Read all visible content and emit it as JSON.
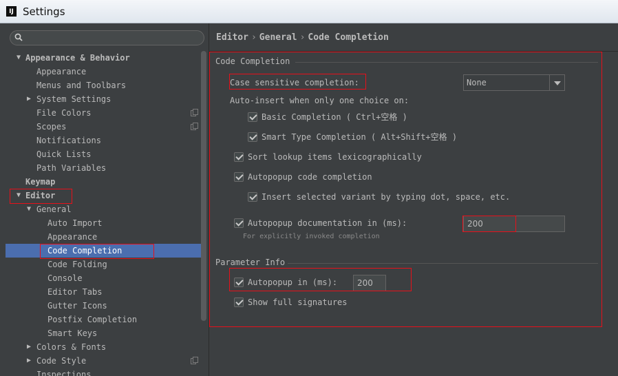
{
  "window": {
    "title": "Settings",
    "app_icon": "IJ"
  },
  "search": {
    "placeholder": ""
  },
  "tree": {
    "appearance_behavior": "Appearance & Behavior",
    "appearance": "Appearance",
    "menus_toolbars": "Menus and Toolbars",
    "system_settings": "System Settings",
    "file_colors": "File Colors",
    "scopes": "Scopes",
    "notifications": "Notifications",
    "quick_lists": "Quick Lists",
    "path_variables": "Path Variables",
    "keymap": "Keymap",
    "editor": "Editor",
    "general": "General",
    "auto_import": "Auto Import",
    "general_appearance": "Appearance",
    "code_completion": "Code Completion",
    "code_folding": "Code Folding",
    "console": "Console",
    "editor_tabs": "Editor Tabs",
    "gutter_icons": "Gutter Icons",
    "postfix_completion": "Postfix Completion",
    "smart_keys": "Smart Keys",
    "colors_fonts": "Colors & Fonts",
    "code_style": "Code Style",
    "inspections": "Inspections"
  },
  "breadcrumb": {
    "part1": "Editor",
    "part2": "General",
    "part3": "Code Completion",
    "separator": "›"
  },
  "code_completion": {
    "group_title": "Code Completion",
    "case_sensitive_label": "Case sensitive completion:",
    "case_sensitive_value": "None",
    "auto_insert_label": "Auto-insert when only one choice on:",
    "basic_completion": "Basic Completion ( Ctrl+空格 )",
    "smart_type_completion": "Smart Type Completion ( Alt+Shift+空格 )",
    "sort_lexicographically": "Sort lookup items lexicographically",
    "autopopup_completion": "Autopopup code completion",
    "insert_selected_variant": "Insert selected variant by typing dot, space, etc.",
    "autopopup_documentation": "Autopopup documentation in (ms):",
    "autopopup_documentation_value": "200",
    "explicit_hint": "For explicitly invoked completion"
  },
  "parameter_info": {
    "group_title": "Parameter Info",
    "autopopup_label": "Autopopup in (ms):",
    "autopopup_value": "200",
    "show_full_signatures": "Show full signatures"
  },
  "colors": {
    "background": "#3c3f41",
    "selection": "#4b6eaf",
    "highlight_box": "#e8101a"
  }
}
